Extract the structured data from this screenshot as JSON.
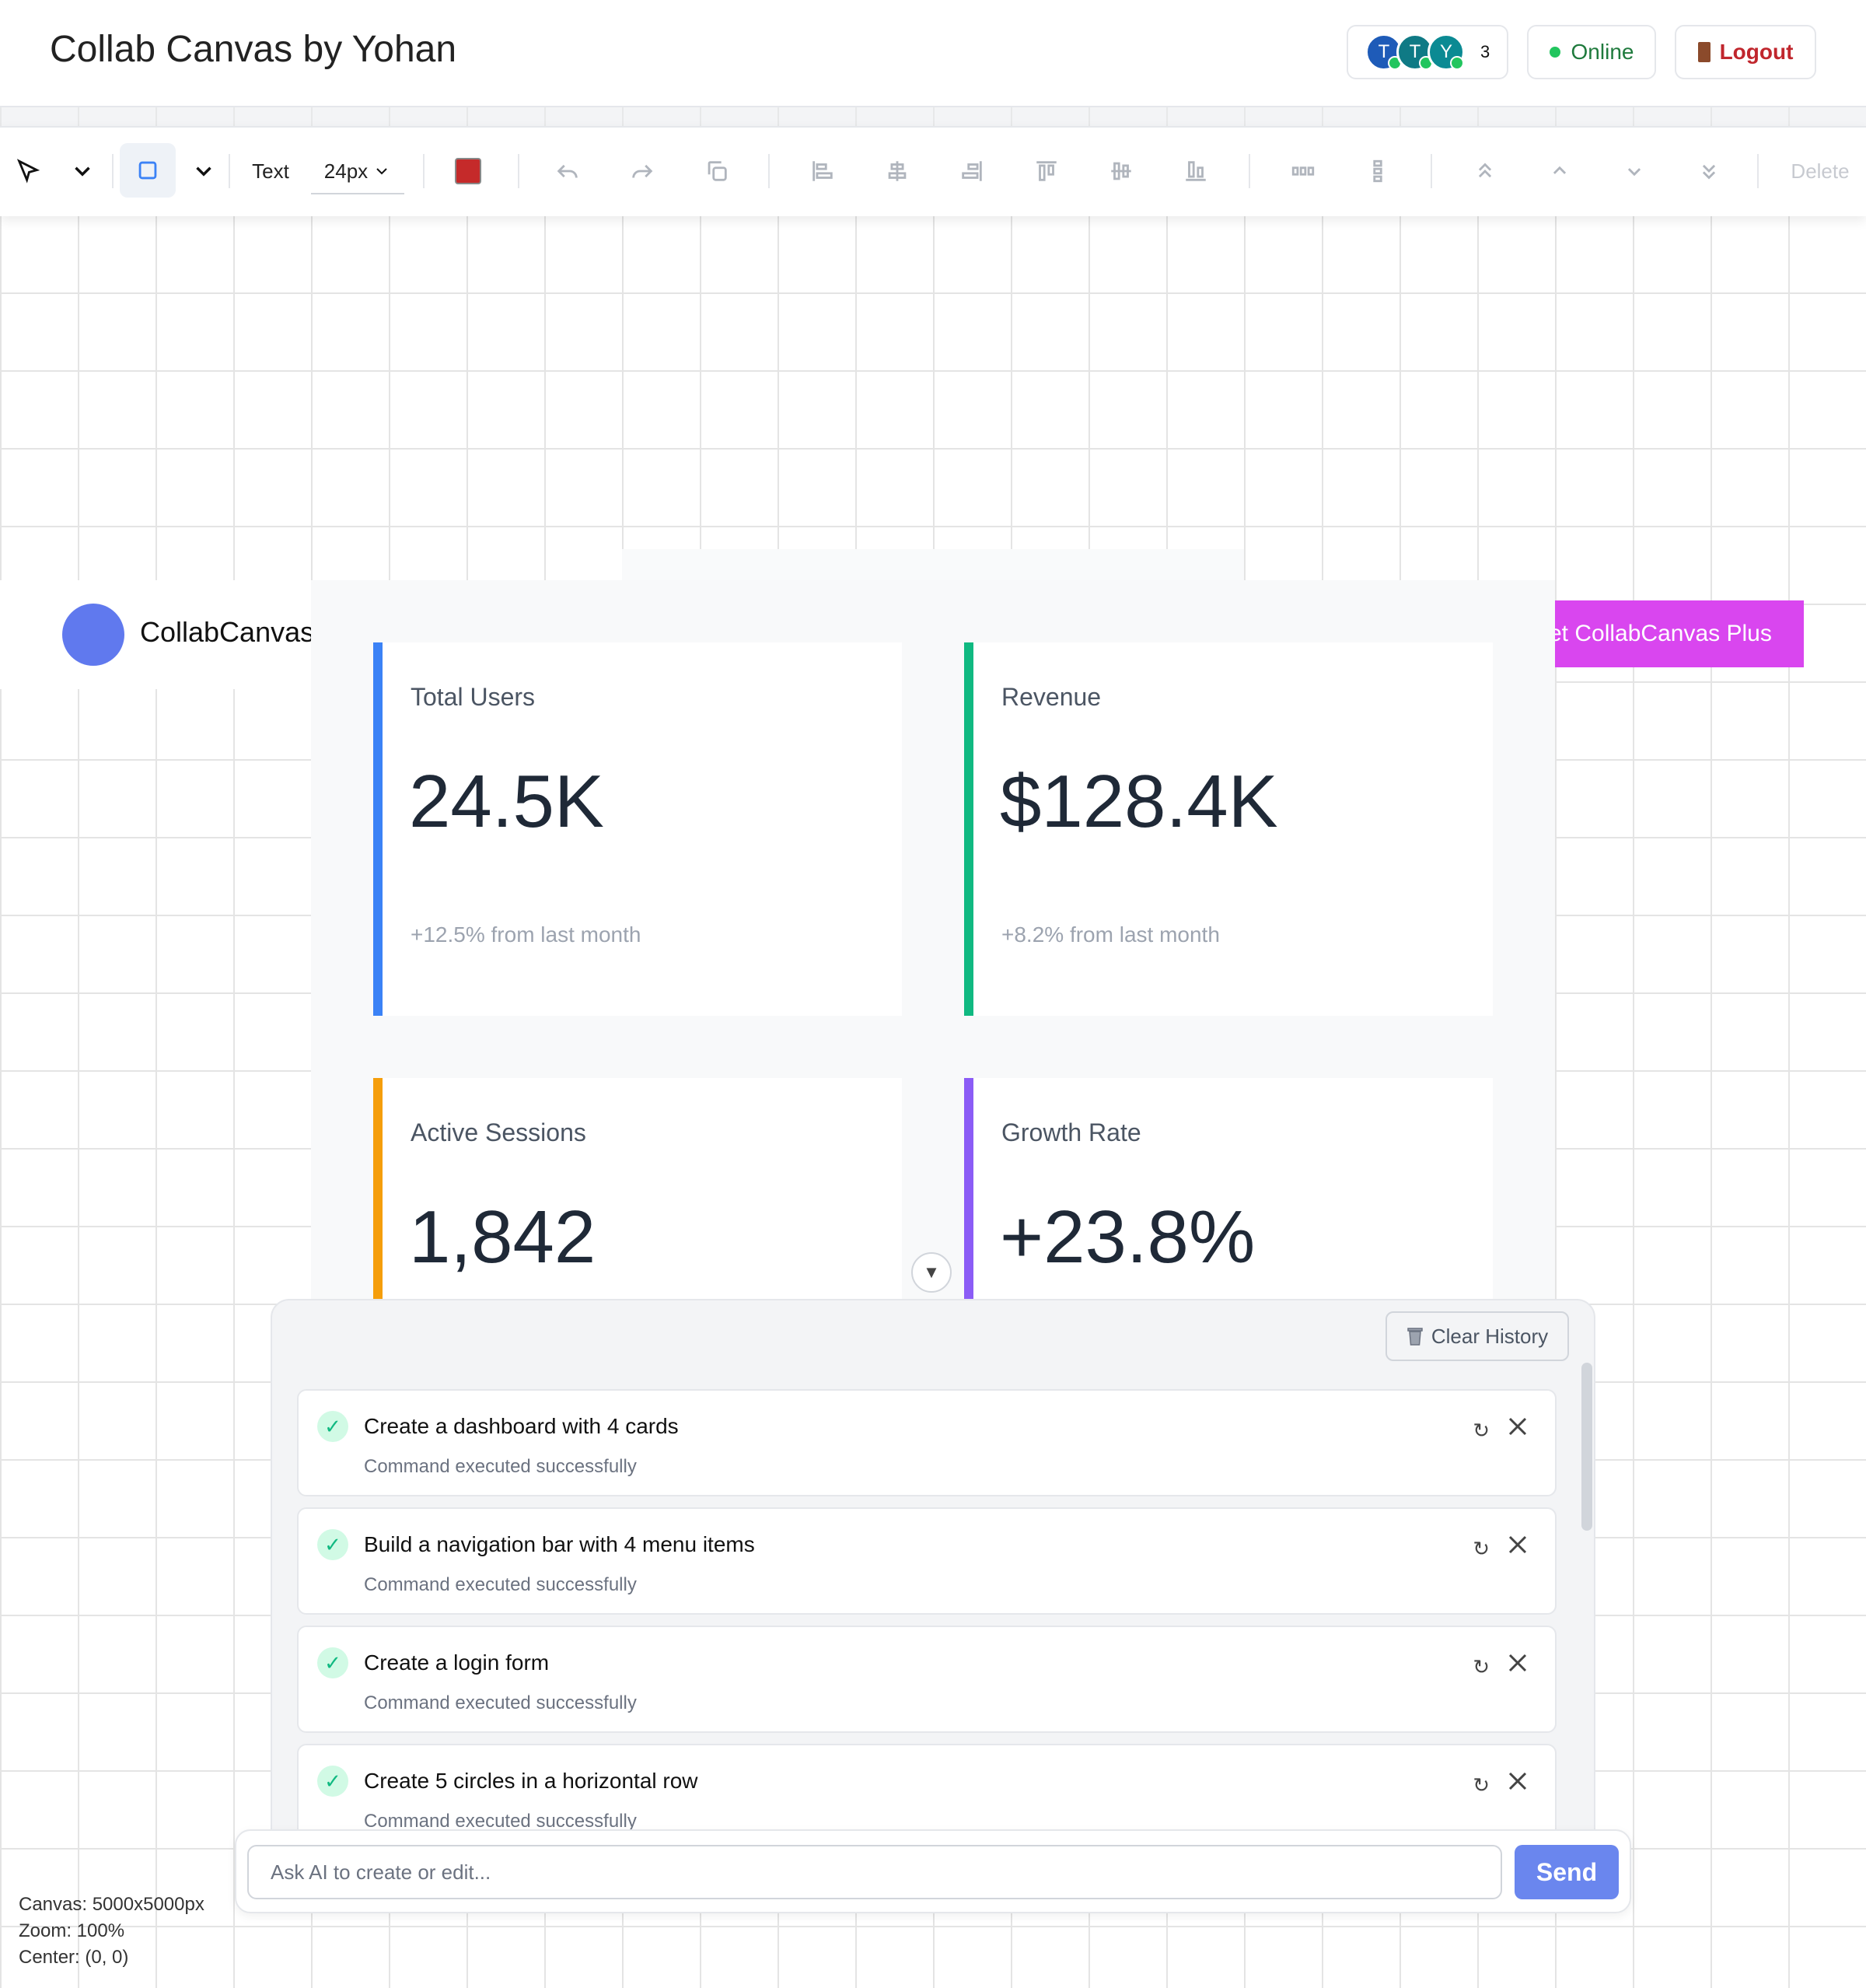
{
  "header": {
    "title": "Collab Canvas by Yohan",
    "avatars": [
      {
        "initial": "T",
        "color": "#1e5bb8"
      },
      {
        "initial": "T",
        "color": "#0f7a85"
      },
      {
        "initial": "Y",
        "color": "#0b8a93"
      }
    ],
    "user_count": "3",
    "status": "Online",
    "logout": "Logout"
  },
  "toolbar": {
    "text_tool": "Text",
    "font_size": "24px",
    "color": "#c52a2a",
    "delete": "Delete"
  },
  "canvas": {
    "nav_brand": "CollabCanvas",
    "plus_button": "et CollabCanvas Plus",
    "cards": [
      {
        "label": "Total Users",
        "value": "24.5K",
        "sub": "+12.5% from last month",
        "color": "#3b82f6"
      },
      {
        "label": "Revenue",
        "value": "$128.4K",
        "sub": "+8.2% from last month",
        "color": "#10b981"
      },
      {
        "label": "Active Sessions",
        "value": "1,842",
        "sub": "",
        "color": "#f59e0b"
      },
      {
        "label": "Growth Rate",
        "value": "+23.8%",
        "sub": "",
        "color": "#8b5cf6"
      }
    ]
  },
  "ai_panel": {
    "collapse": "▼",
    "clear_history": "Clear History",
    "history": [
      {
        "command": "Create a dashboard with 4 cards",
        "status": "Command executed successfully"
      },
      {
        "command": "Build a navigation bar with 4 menu items",
        "status": "Command executed successfully"
      },
      {
        "command": "Create a login form",
        "status": "Command executed successfully"
      },
      {
        "command": "Create 5 circles in a horizontal row",
        "status": "Command executed successfully"
      }
    ],
    "input_placeholder": "Ask AI to create or edit...",
    "send": "Send",
    "retry_glyph": "↻"
  },
  "canvas_info": {
    "size": "Canvas: 5000x5000px",
    "zoom": "Zoom: 100%",
    "center": "Center: (0, 0)"
  }
}
